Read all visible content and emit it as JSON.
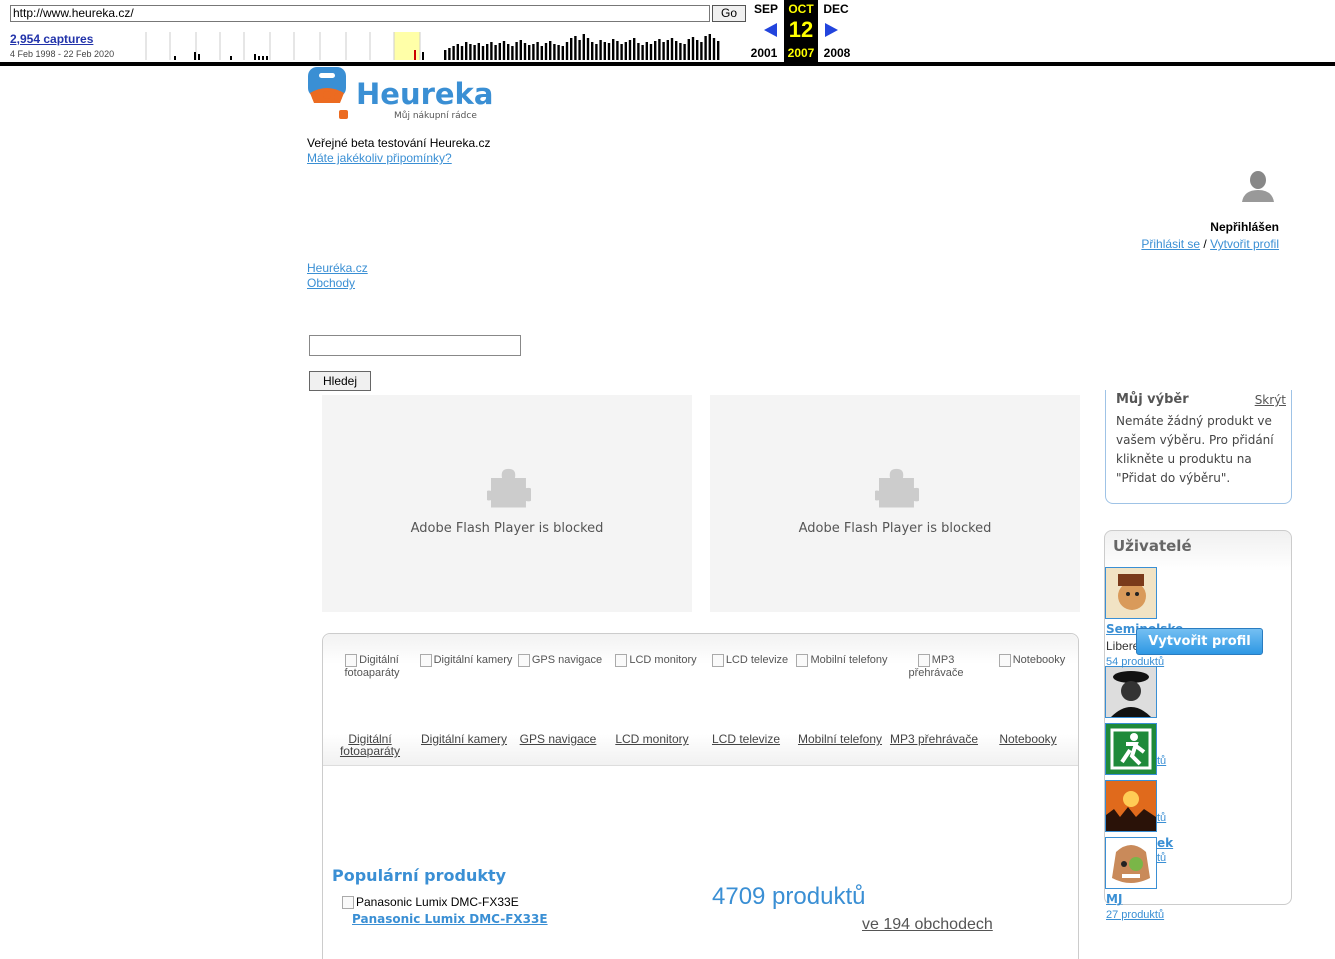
{
  "wayback": {
    "url": "http://www.heureka.cz/",
    "go_label": "Go",
    "captures": "2,954 captures",
    "range": "4 Feb 1998 - 22 Feb 2020",
    "prev_month": "SEP",
    "cur_month": "OCT",
    "next_month": "DEC",
    "cur_day": "12",
    "prev_year": "2001",
    "cur_year": "2007",
    "next_year": "2008"
  },
  "header": {
    "logo_text": "Heureka!",
    "logo_tagline": "Můj nákupní rádce",
    "beta_text": "Veřejné beta testování Heureka.cz",
    "feedback_link": "Máte jakékoliv připomínky?"
  },
  "user": {
    "status": "Nepřihlášen",
    "login": "Přihlásit se",
    "separator": " / ",
    "create": "Vytvořit profil"
  },
  "nav": [
    "Heuréka.cz",
    "Obchody"
  ],
  "search": {
    "value": "",
    "button": "Hledej"
  },
  "flash": {
    "message": "Adobe Flash Player is blocked"
  },
  "categories": [
    {
      "img_alt": "Digitální fotoaparáty",
      "label": "Digitální fotoaparáty"
    },
    {
      "img_alt": "Digitální kamery",
      "label": "Digitální kamery"
    },
    {
      "img_alt": "GPS navigace",
      "label": "GPS navigace"
    },
    {
      "img_alt": "LCD monitory",
      "label": "LCD monitory"
    },
    {
      "img_alt": "LCD televize",
      "label": "LCD televize"
    },
    {
      "img_alt": "Mobilní telefony",
      "label": "Mobilní telefony"
    },
    {
      "img_alt": "MP3 přehrávače",
      "label": "MP3 přehrávače"
    },
    {
      "img_alt": "Notebooky",
      "label": "Notebooky"
    }
  ],
  "popular": {
    "title": "Populární produkty",
    "img_alt": "Panasonic Lumix DMC-FX33E",
    "link": "Panasonic Lumix DMC-FX33E"
  },
  "stats": {
    "products": "4709 produktů",
    "shops": "ve 194 obchodech"
  },
  "my_selection": {
    "title": "Můj výběr",
    "hide": "Skrýt",
    "text": "Nemáte žádný produkt ve vašem výběru. Pro přidání klikněte u produktu na \"Přidat do výběru\"."
  },
  "users": {
    "title": "Uživatelé",
    "u1_name": "Seminolske",
    "u1_city": "Liberec",
    "u1_count": "54 produktů",
    "u3_count": "tů",
    "u4_count": "tů",
    "u5_name": "ek",
    "u5_count": "tů",
    "u6_name": "MJ",
    "u6_count": "27 produktů",
    "create_button": "Vytvořit profil"
  },
  "colors": {
    "link": "#3a8fd4",
    "logo_orange": "#ec6b21",
    "logo_blue": "#3a8fd4",
    "wb_highlight": "#ffff00"
  }
}
